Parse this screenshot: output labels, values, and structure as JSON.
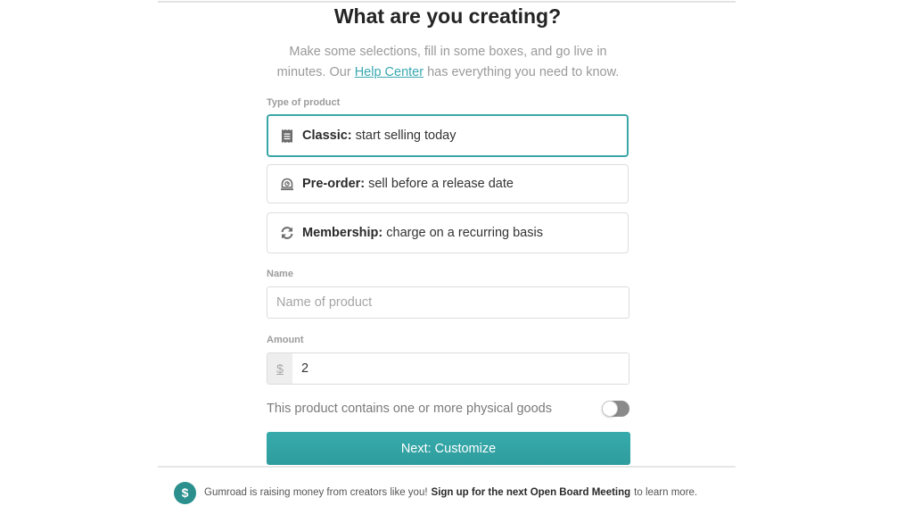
{
  "header": {
    "title": "What are you creating?",
    "subtitle_before": "Make some selections, fill in some boxes, and go live in minutes. Our ",
    "help_link": "Help Center",
    "subtitle_after": " has everything you need to know."
  },
  "product_type": {
    "label": "Type of product",
    "selected": "classic",
    "options": [
      {
        "id": "classic",
        "icon": "receipt-icon",
        "title": "Classic:",
        "description": "start selling today"
      },
      {
        "id": "preorder",
        "icon": "alarm-bell-icon",
        "title": "Pre-order:",
        "description": "sell before a release date"
      },
      {
        "id": "membership",
        "icon": "refresh-icon",
        "title": "Membership:",
        "description": "charge on a recurring basis"
      }
    ]
  },
  "name_field": {
    "label": "Name",
    "placeholder": "Name of product",
    "value": ""
  },
  "amount_field": {
    "label": "Amount",
    "currency_symbol": "$",
    "value": "2"
  },
  "physical_goods": {
    "label": "This product contains one or more physical goods",
    "enabled": false
  },
  "next_button": {
    "label": "Next: Customize"
  },
  "banner": {
    "icon": "dollar-coin-icon",
    "icon_glyph": "$",
    "text_before": "Gumroad is raising money from creators like you!",
    "link": "Sign up for the next Open Board Meeting",
    "text_after": "to learn more."
  },
  "colors": {
    "accent": "#3ba6a6",
    "button": "#33a3a4",
    "link": "#38a8b0",
    "coin": "#2a8f8d"
  }
}
